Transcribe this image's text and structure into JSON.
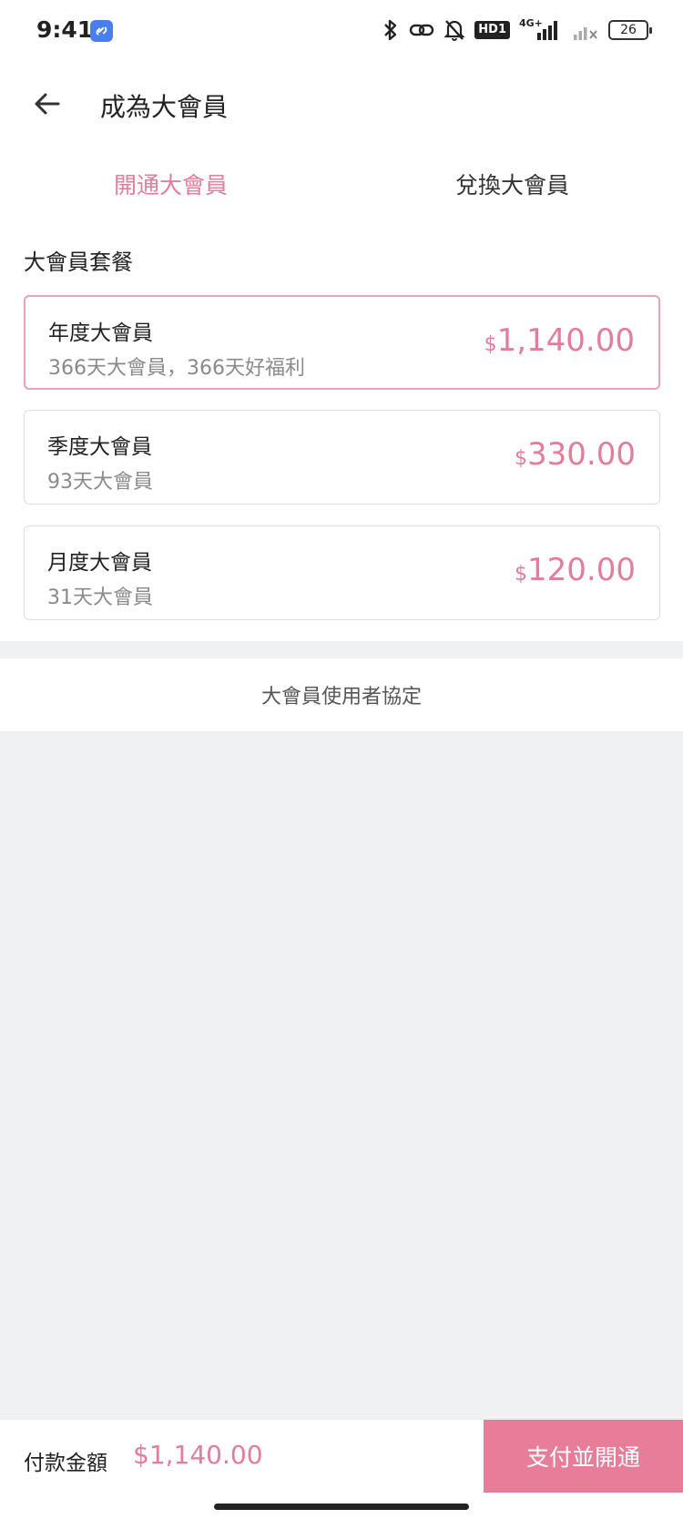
{
  "status_bar": {
    "time": "9:41",
    "network": "4G+",
    "hd_badge": "HD1",
    "battery": "26"
  },
  "header": {
    "title": "成為大會員"
  },
  "tabs": [
    {
      "label": "開通大會員",
      "active": true
    },
    {
      "label": "兌換大會員",
      "active": false
    }
  ],
  "packages": {
    "section_title": "大會員套餐",
    "plans": [
      {
        "name": "年度大會員",
        "desc": "366天大會員，366天好福利",
        "currency": "$",
        "price": "1,140.00",
        "selected": true
      },
      {
        "name": "季度大會員",
        "desc": "93天大會員",
        "currency": "$",
        "price": "330.00",
        "selected": false
      },
      {
        "name": "月度大會員",
        "desc": "31天大會員",
        "currency": "$",
        "price": "120.00",
        "selected": false
      }
    ]
  },
  "agreement": {
    "label": "大會員使用者協定"
  },
  "footer": {
    "pay_label": "付款金額",
    "pay_amount": "$1,140.00",
    "pay_button": "支付並開通"
  },
  "colors": {
    "accent": "#e47c9b",
    "button": "#e87d9a",
    "selected_border": "#e8a1b6",
    "background": "#f0f1f3"
  }
}
